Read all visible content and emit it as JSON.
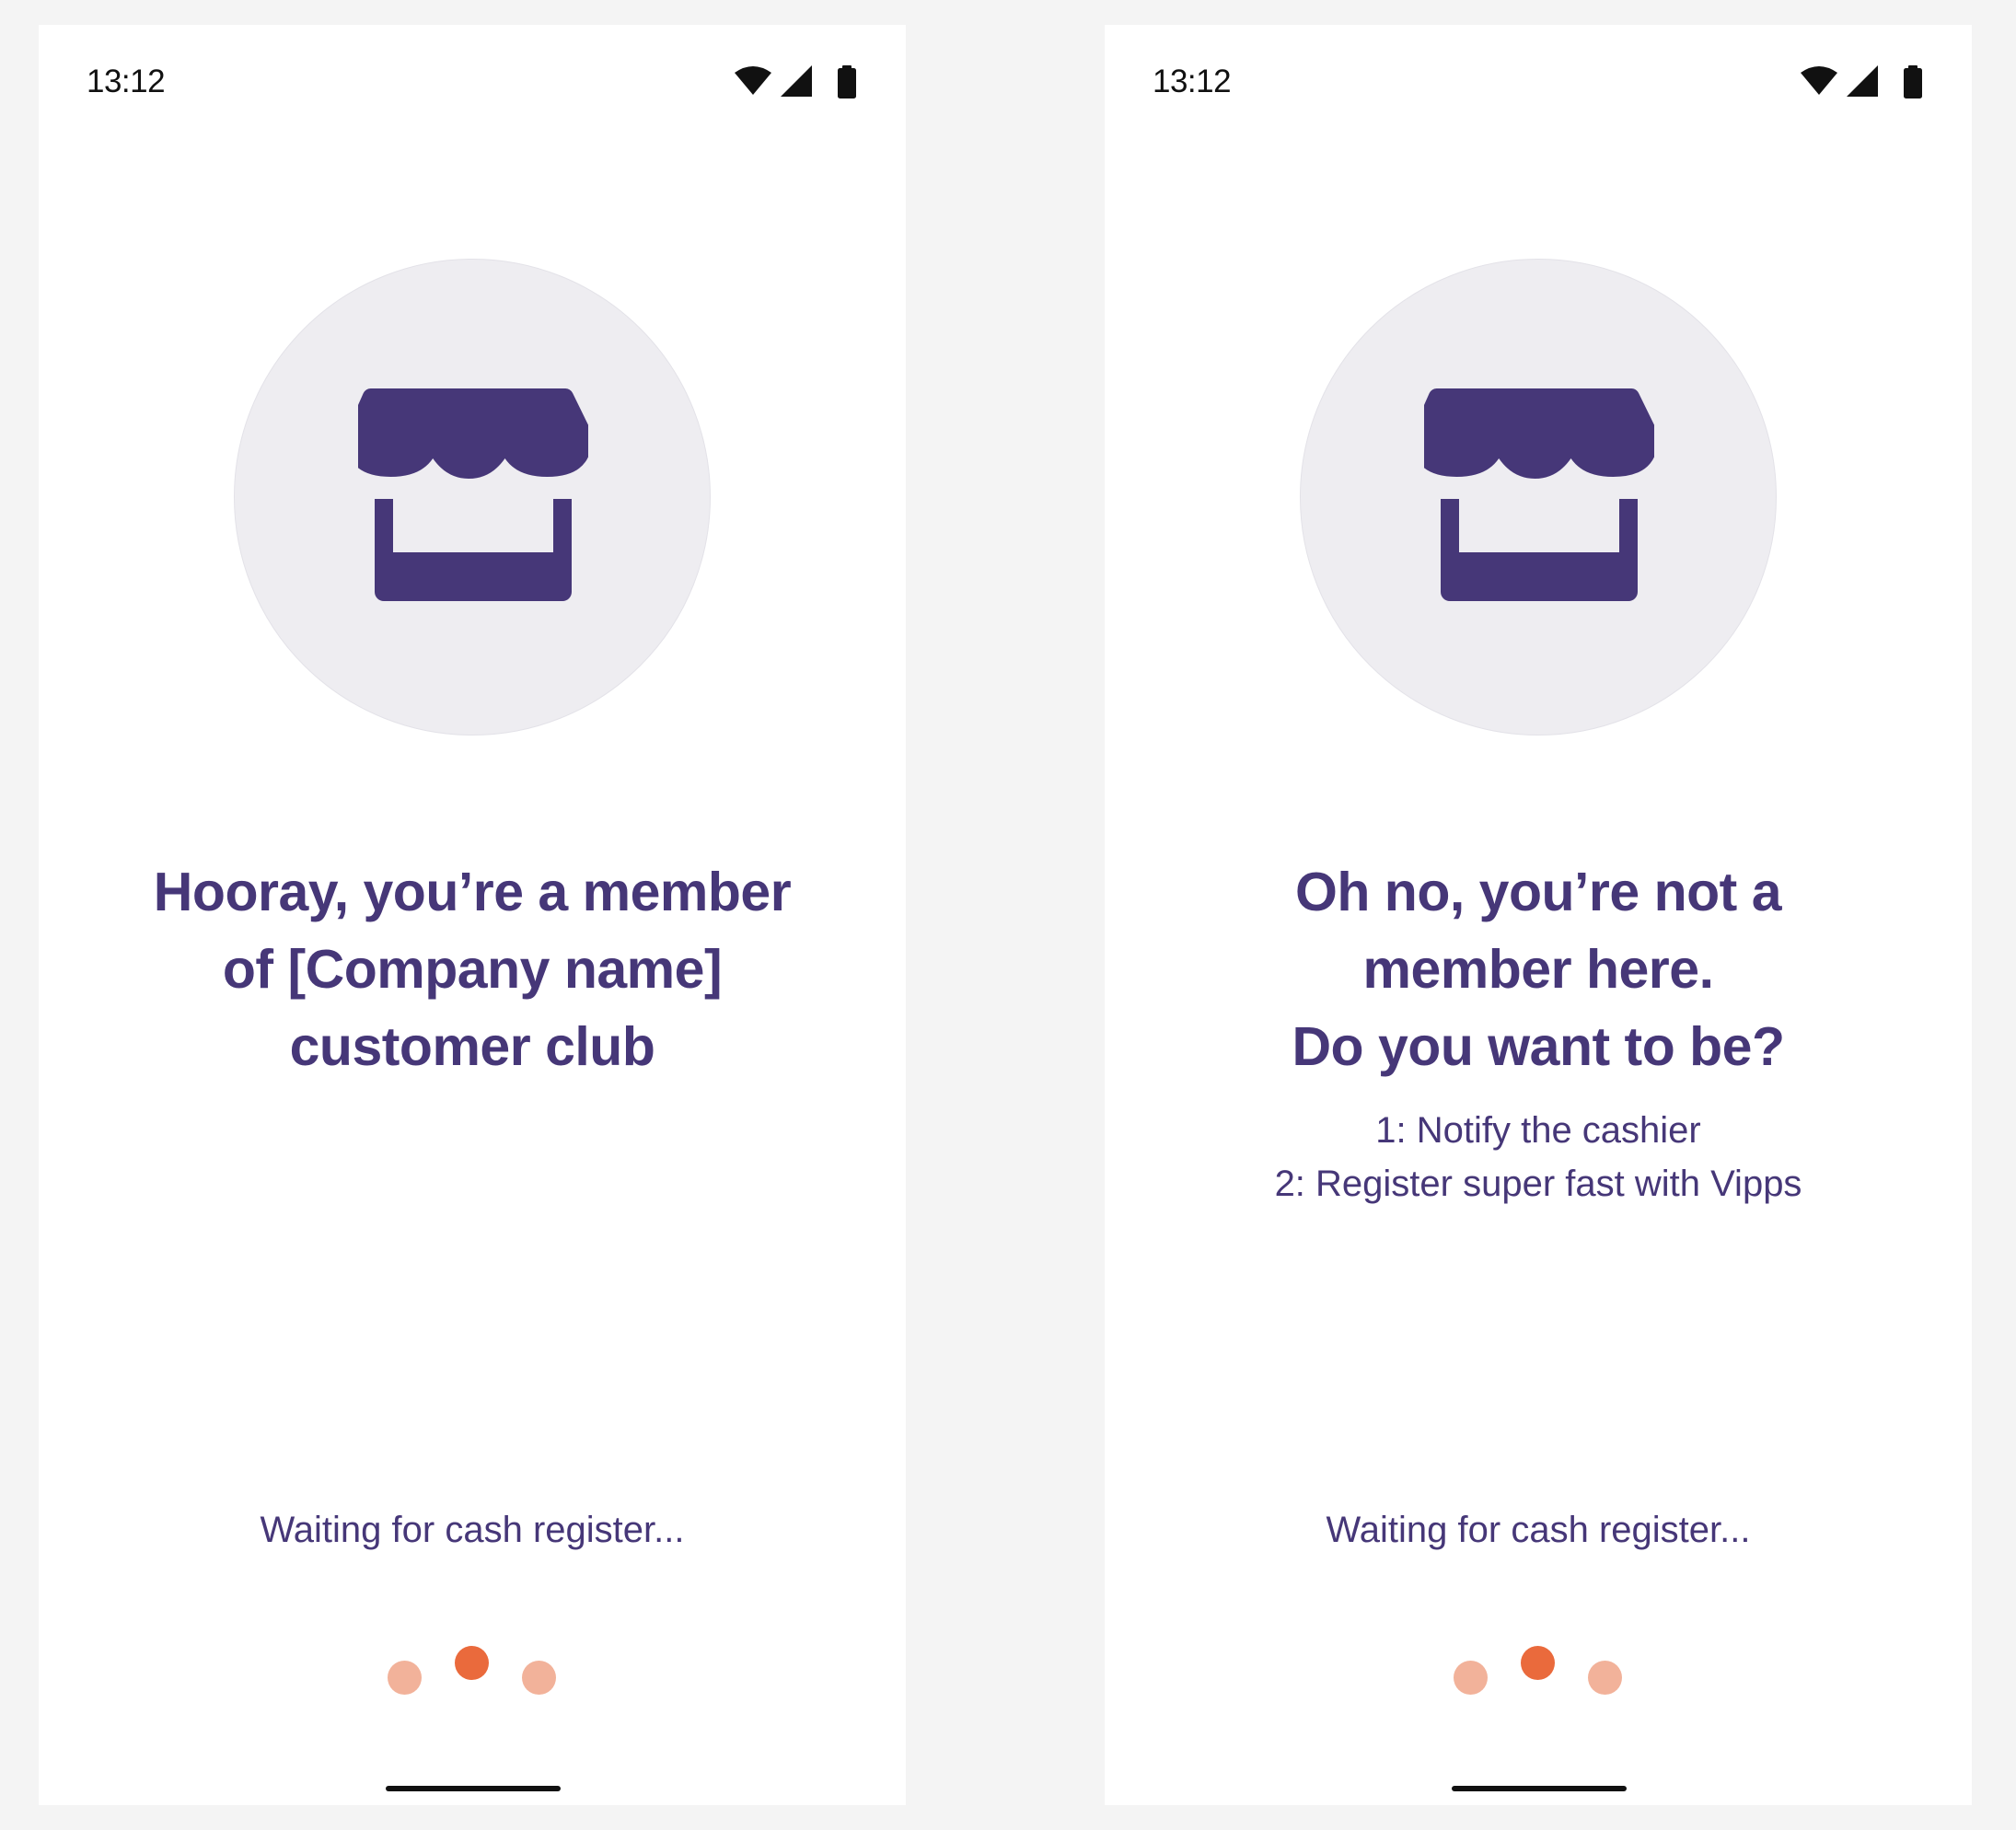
{
  "colors": {
    "page_background": "#f4f4f4",
    "screen_background": "#ffffff",
    "brand_purple": "#463778",
    "icon_circle": "#eeedf1",
    "dot_active": "#ea6a3c",
    "dot_inactive": "#f2b29a"
  },
  "screens": [
    {
      "status_bar": {
        "time": "13:12",
        "icons": [
          "wifi-icon",
          "cellular-signal-icon",
          "battery-icon"
        ]
      },
      "illustration_icon": "storefront-icon",
      "headline_lines": [
        "Hooray, you’re a member",
        "of [Company name]",
        "customer club"
      ],
      "steps": [],
      "waiting_text": "Waiting for cash register...",
      "loading_dots": {
        "count": 3,
        "active_index": 1
      }
    },
    {
      "status_bar": {
        "time": "13:12",
        "icons": [
          "wifi-icon",
          "cellular-signal-icon",
          "battery-icon"
        ]
      },
      "illustration_icon": "storefront-icon",
      "headline_lines": [
        "Oh no, you’re not a",
        "member here.",
        "Do you want to be?"
      ],
      "steps": [
        "1: Notify the cashier",
        "2: Register super fast with Vipps"
      ],
      "waiting_text": "Waiting for cash register...",
      "loading_dots": {
        "count": 3,
        "active_index": 1
      }
    }
  ]
}
